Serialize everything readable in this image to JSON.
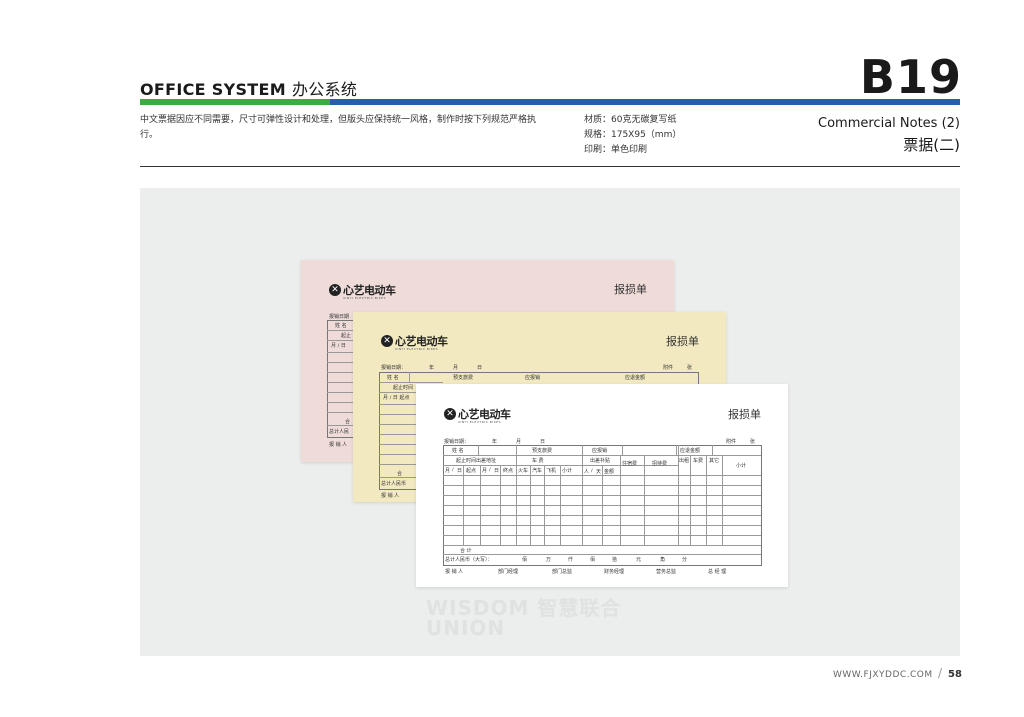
{
  "header": {
    "title_en": "OFFICE SYSTEM",
    "title_cn": "办公系统",
    "code": "B19",
    "description": "中文票据因应不同需要，尺寸可弹性设计和处理，但版头应保持统一风格，制作时按下列规范严格执行。",
    "specs": [
      "材质：60克无碳复写纸",
      "规格：175X95（mm）",
      "印刷：单色印刷"
    ],
    "subtitle_en": "Commercial Notes (2)",
    "subtitle_cn": "票据(二)"
  },
  "colors": {
    "green": "#3bab44",
    "blue": "#2660ad",
    "pink": "#efdcd9",
    "yellow": "#f2e9c1"
  },
  "form": {
    "brand": "心艺电动车",
    "brand_sub": "XINYI ELECTRIC BIKES",
    "title": "报损单",
    "date_label": "报销日期：",
    "year": "年",
    "month": "月",
    "day": "日",
    "attachment": "附件",
    "sheets": "张",
    "name": "姓 名",
    "advance": "预支旅费",
    "reimburse": "应报销",
    "refund": "应退金额",
    "period": "起止时间出差地址",
    "fare": "车     费",
    "allowance": "出差补贴",
    "hotel": "住宿费",
    "entertain": "招待费",
    "taxi": "出租",
    "rent": "车费",
    "other": "其它",
    "subtotal_col": "小计",
    "sub_cols": [
      "月",
      "/",
      "日",
      "起点",
      "月",
      "/",
      "日",
      "终点",
      "火车",
      "汽车",
      "飞机",
      "小计",
      "人",
      "/",
      "天",
      "金额"
    ],
    "total": "合     计",
    "rmb_total": "总计人民币（大写）：",
    "units": [
      "佰",
      "万",
      "仟",
      "佰",
      "拾",
      "元",
      "角",
      "分"
    ],
    "signatures": [
      "报 销 人",
      "部门经理",
      "部门总监",
      "财务经理",
      "营务总监",
      "总 经 理"
    ],
    "pink_partial": {
      "date": "报销日期",
      "name": "姓 名",
      "period": "起止",
      "md": "月 / 日",
      "total": "合",
      "rmb": "总计人民",
      "sign": "报 销 人"
    },
    "yellow_partial": {
      "date": "报销日期：",
      "year": "年",
      "month": "月",
      "day": "日",
      "attachment": "附件",
      "sheets": "张",
      "name": "姓 名",
      "advance": "预支旅费",
      "reimburse": "应报销",
      "refund": "应退金额",
      "period": "起止时间",
      "md": "月 / 日  起点",
      "total": "合",
      "rmb": "总计人民币",
      "sign": "报 销 人"
    }
  },
  "watermark": [
    "WISDOM 智慧联合",
    "UNION"
  ],
  "footer": {
    "url": "WWW.FJXYDDC.COM",
    "page": "58"
  }
}
